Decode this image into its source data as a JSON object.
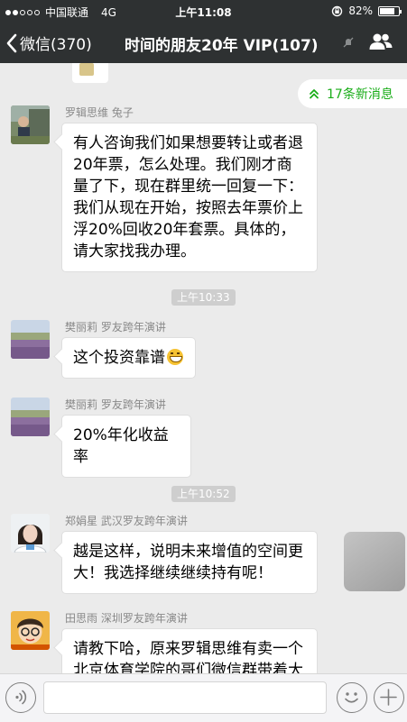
{
  "status_bar": {
    "carrier": "中国联通",
    "network": "4G",
    "time": "上午11:08",
    "battery": "82%",
    "battery_level": 0.82
  },
  "nav": {
    "back_label": "微信(370)",
    "title": "时间的朋友20年 VIP(107)"
  },
  "new_messages": "17条新消息",
  "messages": [
    {
      "sender": "罗辑思维 兔子",
      "lines": [
        "有人咨询我们如果想要转让或者退",
        "20年票，怎么处理。我们刚才商",
        "量了下，现在群里统一回复一下：",
        "我们从现在开始，按照去年票价上",
        "浮20%回收20年套票。具体的，",
        "请大家找我办理。"
      ]
    },
    {
      "time": "上午10:33"
    },
    {
      "sender": "樊丽莉 罗友跨年演讲",
      "lines": [
        "这个投资靠谱"
      ]
    },
    {
      "sender": "樊丽莉 罗友跨年演讲",
      "lines": [
        "20%年化收益率"
      ]
    },
    {
      "time": "上午10:52"
    },
    {
      "sender": "郑娟星 武汉罗友跨年演讲",
      "lines": [
        "越是这样，说明未来增值的空间更",
        "大！我选择继续继续持有呢！"
      ]
    },
    {
      "sender": "田思雨 深圳罗友跨年演讲",
      "lines": [
        "请教下哈，原来罗辑思维有卖一个",
        "北京体育学院的哥们微信群带着大"
      ]
    }
  ],
  "colors": {
    "nav_bg": "#2e3132",
    "chat_bg": "#ebebeb",
    "accent": "#1aad19"
  },
  "icons": [
    "back-chevron-icon",
    "mute-icon",
    "group-members-icon",
    "double-chevron-up-icon",
    "voice-icon",
    "emoji-icon",
    "plus-icon"
  ]
}
